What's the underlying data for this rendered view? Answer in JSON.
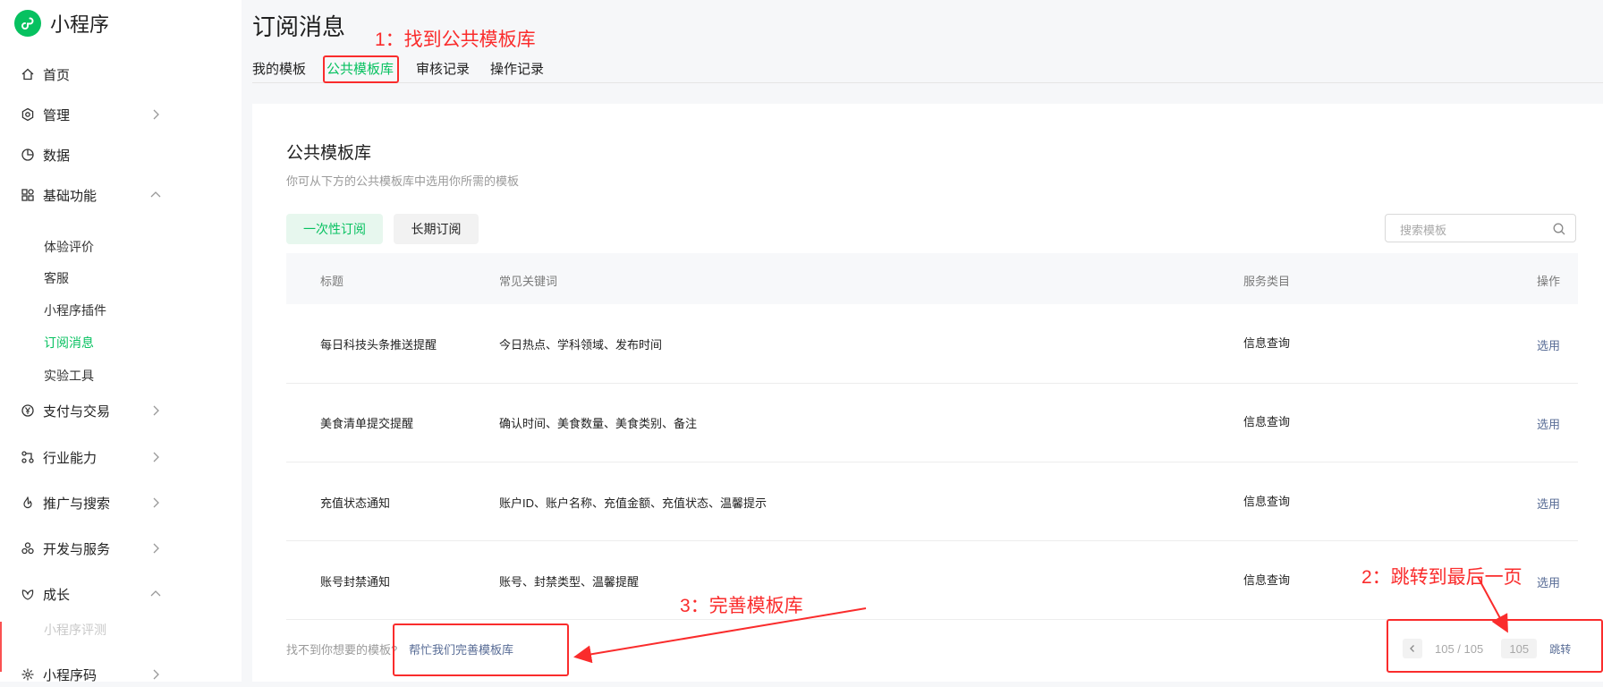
{
  "brand": {
    "name": "小程序"
  },
  "sidebar": {
    "items": [
      {
        "label": "首页",
        "icon": "home-icon"
      },
      {
        "label": "管理",
        "icon": "settings-icon"
      },
      {
        "label": "数据",
        "icon": "pie-chart-icon"
      },
      {
        "label": "基础功能",
        "icon": "apps-icon"
      },
      {
        "label": "支付与交易",
        "icon": "yuan-icon"
      },
      {
        "label": "行业能力",
        "icon": "industry-icon"
      },
      {
        "label": "推广与搜索",
        "icon": "flame-icon"
      },
      {
        "label": "开发与服务",
        "icon": "dev-icon"
      },
      {
        "label": "成长",
        "icon": "growth-icon"
      },
      {
        "label": "小程序码",
        "icon": "qrcode-icon"
      }
    ],
    "basic_sub": [
      "体验评价",
      "客服",
      "小程序插件",
      "订阅消息",
      "实验工具"
    ],
    "growth_sub": [
      "小程序评测"
    ]
  },
  "page": {
    "title": "订阅消息"
  },
  "tabs": [
    {
      "label": "我的模板"
    },
    {
      "label": "公共模板库"
    },
    {
      "label": "审核记录"
    },
    {
      "label": "操作记录"
    }
  ],
  "library": {
    "title": "公共模板库",
    "subtitle": "你可从下方的公共模板库中选用你所需的模板",
    "segments": [
      "一次性订阅",
      "长期订阅"
    ],
    "search_placeholder": "搜索模板"
  },
  "table": {
    "headers": [
      "标题",
      "常见关键词",
      "服务类目",
      "操作"
    ],
    "rows": [
      {
        "title": "每日科技头条推送提醒",
        "keywords": "今日热点、学科领域、发布时间",
        "category": "信息查询",
        "action": "选用"
      },
      {
        "title": "美食清单提交提醒",
        "keywords": "确认时间、美食数量、美食类别、备注",
        "category": "信息查询",
        "action": "选用"
      },
      {
        "title": "充值状态通知",
        "keywords": "账户ID、账户名称、充值金额、充值状态、温馨提示",
        "category": "信息查询",
        "action": "选用"
      },
      {
        "title": "账号封禁通知",
        "keywords": "账号、封禁类型、温馨提醒",
        "category": "信息查询",
        "action": "选用"
      }
    ]
  },
  "footer": {
    "hint": "找不到你想要的模板?",
    "link": "帮忙我们完善模板库"
  },
  "pagination": {
    "current": 105,
    "total": 105,
    "display": "105 / 105",
    "jump_value": "105",
    "jump_label": "跳转"
  },
  "annotations": {
    "a1": "1：找到公共模板库",
    "a2": "2：跳转到最后一页",
    "a3": "3：完善模板库",
    "color": "#fa2c2c"
  },
  "colors": {
    "accent": "#07c160",
    "link": "#576b95"
  }
}
